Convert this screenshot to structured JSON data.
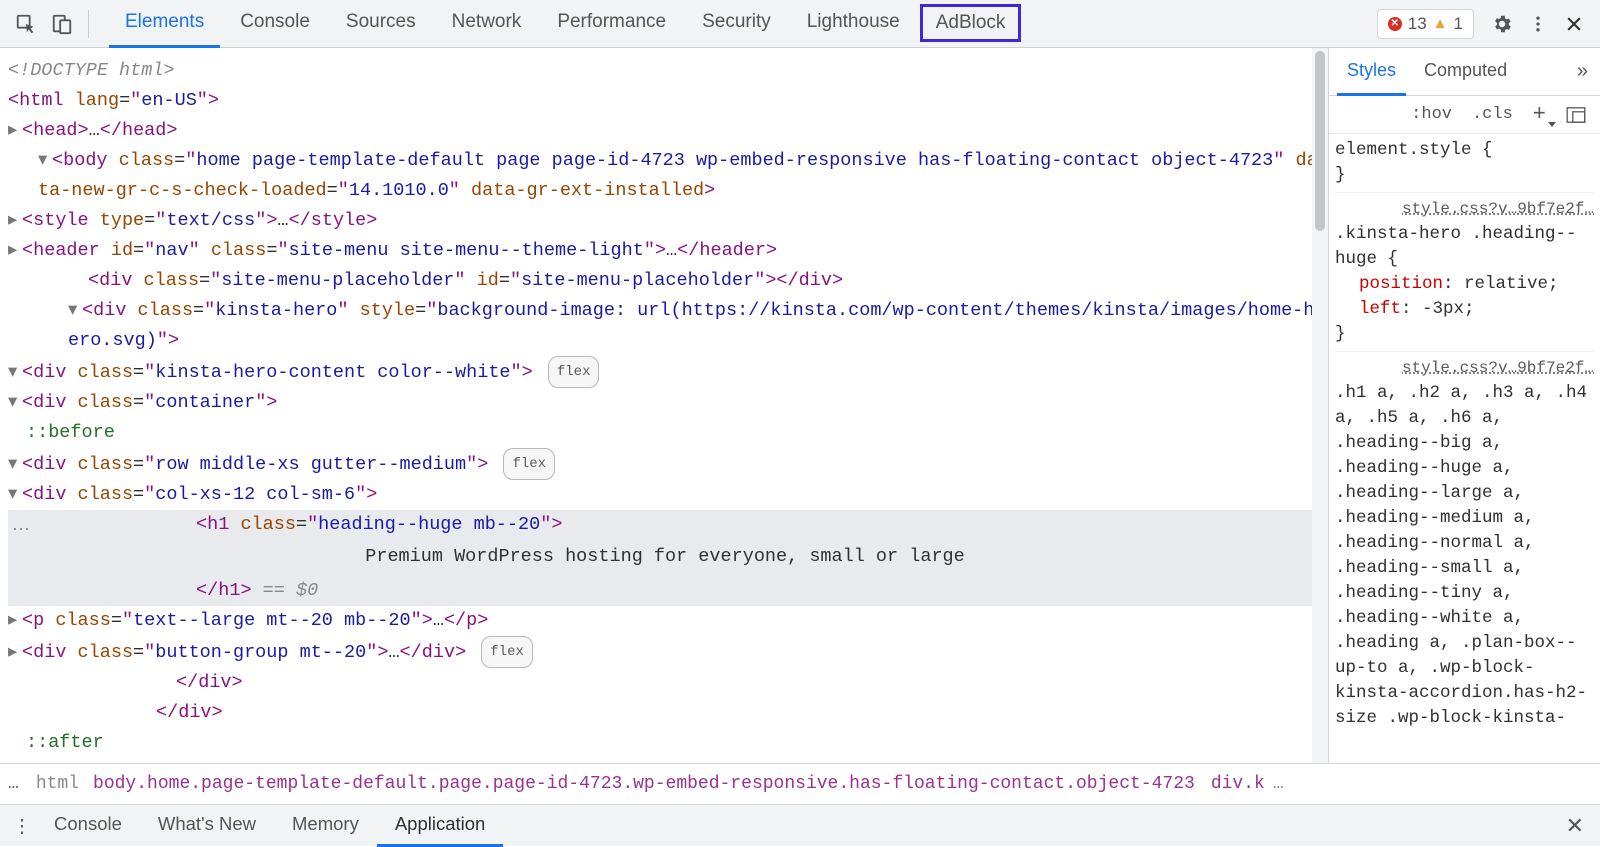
{
  "topbar": {
    "tabs": [
      "Elements",
      "Console",
      "Sources",
      "Network",
      "Performance",
      "Security",
      "Lighthouse",
      "AdBlock"
    ],
    "activeTab": "Elements",
    "highlightedTab": "AdBlock",
    "errorCount": "13",
    "warnCount": "1"
  },
  "dom": {
    "doctype": "<!DOCTYPE html>",
    "htmlLang": "en-US",
    "bodyClass": "home page-template-default page page-id-4723 wp-embed-responsive has-floating-contact object-4723",
    "bodyAttrName": "data-new-gr-c-s-check-loaded",
    "bodyAttrVal": "14.1010.0",
    "bodyAttr2": "data-gr-ext-installed",
    "styleType": "text/css",
    "headerId": "nav",
    "headerClass": "site-menu site-menu--theme-light",
    "placeholderClass": "site-menu-placeholder",
    "placeholderId": "site-menu-placeholder",
    "heroDivClass": "kinsta-hero",
    "heroStyle": "background-image: url(https://kinsta.com/wp-content/themes/kinsta/images/home-hero.svg)",
    "heroContentClass": "kinsta-hero-content color--white",
    "containerClass": "container",
    "before": "::before",
    "rowClass": "row middle-xs gutter--medium",
    "colClass": "col-xs-12 col-sm-6",
    "h1Class": "heading--huge mb--20",
    "h1Text": "Premium WordPress hosting for everyone, small or large",
    "eqD0": "== $0",
    "pClass": "text--large mt--20 mb--20",
    "btnGroupClass": "button-group mt--20",
    "after": "::after",
    "flexBadge": "flex"
  },
  "crumb": {
    "html": "html",
    "body": "body.home.page-template-default.page.page-id-4723.wp-embed-responsive.has-floating-contact.object-4723",
    "divk": "div.k",
    "more": "…"
  },
  "styles": {
    "tabs": [
      "Styles",
      "Computed"
    ],
    "activeTab": "Styles",
    "hov": ":hov",
    "cls": ".cls",
    "elemStyle": "element.style {",
    "closeBrace": "}",
    "srcLink": "style.css?v…9bf7e2f…",
    "rule1Sel": ".kinsta-hero .heading--huge {",
    "rule1Props": [
      {
        "p": "position",
        "v": "relative;"
      },
      {
        "p": "left",
        "v": "-3px;"
      }
    ],
    "rule2Sel": ".h1 a, .h2 a, .h3 a, .h4 a, .h5 a, .h6 a, .heading--big a, .heading--huge a, .heading--large a, .heading--medium a, .heading--normal a, .heading--small a, .heading--tiny a, .heading--white a, .heading a, .plan-box--up-to a, .wp-block-kinsta-accordion.has-h2-size .wp-block-kinsta-"
  },
  "drawer": {
    "tabs": [
      "Console",
      "What's New",
      "Memory",
      "Application"
    ],
    "activeTab": "Application"
  }
}
